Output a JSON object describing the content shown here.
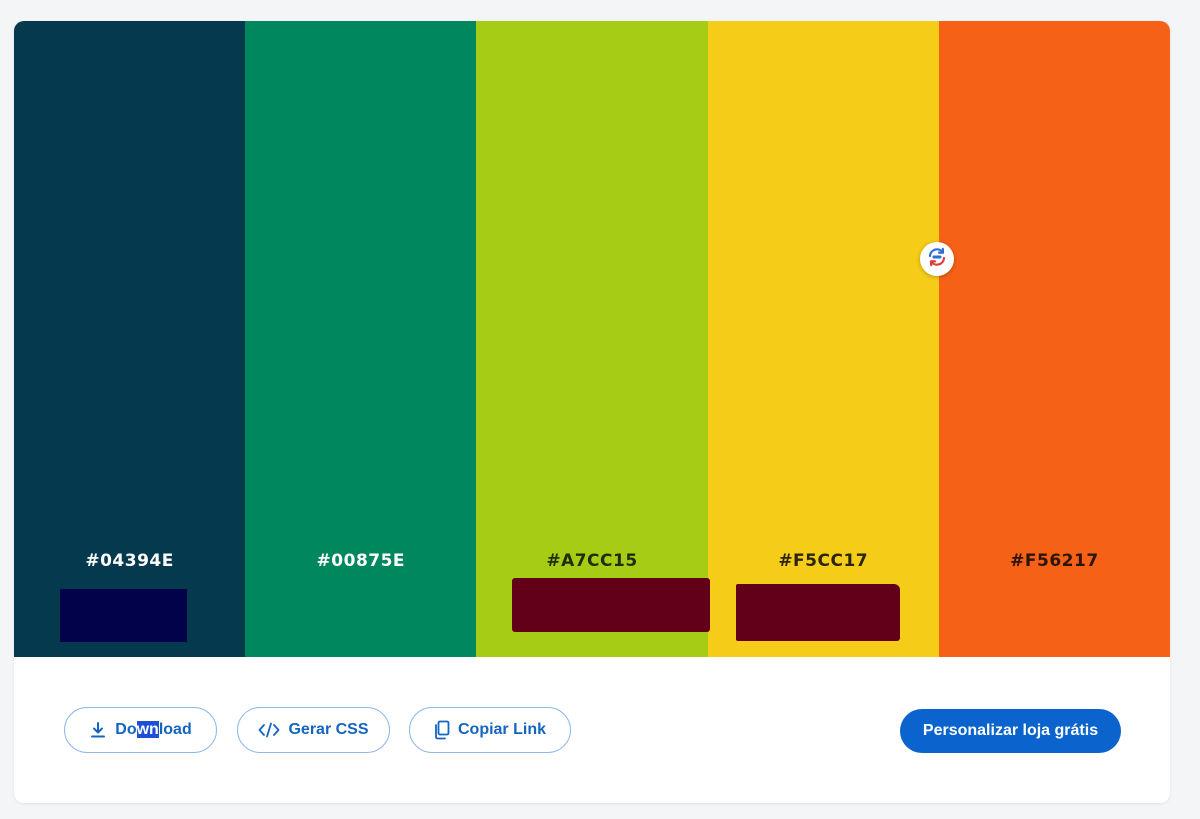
{
  "palette": {
    "swatches": [
      {
        "hex": "#04394E",
        "color": "#04394E",
        "text_color": "#ffffff"
      },
      {
        "hex": "#00875E",
        "color": "#00875E",
        "text_color": "#ffffff"
      },
      {
        "hex": "#A7CC15",
        "color": "#A7CC15",
        "text_color": "#1f2d0a"
      },
      {
        "hex": "#F5CC17",
        "color": "#F5CC17",
        "text_color": "#2b2410"
      },
      {
        "hex": "#F56217",
        "color": "#F56217",
        "text_color": "#2b1408"
      }
    ],
    "swap_icon": "swap-arrows-icon"
  },
  "actions": {
    "download": {
      "label_start": "Do",
      "label_highlight": "wn",
      "label_end": "load",
      "icon": "download-icon"
    },
    "css": {
      "label": "Gerar CSS",
      "icon": "code-icon"
    },
    "copy": {
      "label": "Copiar Link",
      "icon": "copy-icon"
    },
    "customize": {
      "label": "Personalizar loja grátis"
    }
  },
  "colors": {
    "accent": "#0b63ce",
    "outline": "#8fb8e6",
    "redaction_navy": "#02024a",
    "redaction_maroon": "#610016"
  }
}
